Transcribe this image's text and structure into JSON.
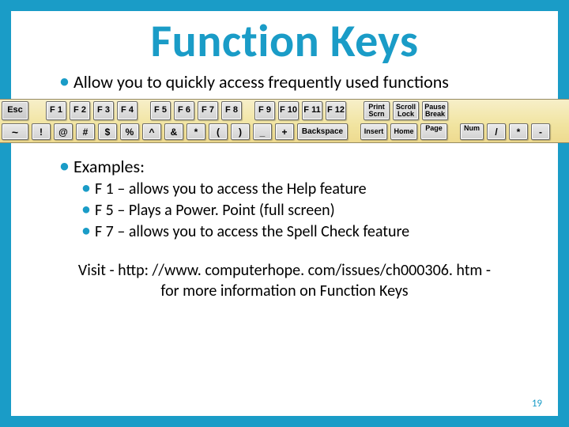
{
  "title": "Function Keys",
  "bullets": {
    "intro": "Allow you to quickly access frequently used functions",
    "examples_label": "Examples:",
    "examples": [
      "F 1 – allows you to access the Help feature",
      "F 5 – Plays a Power. Point (full screen)",
      "F 7 – allows you to access the Spell Check feature"
    ]
  },
  "visit": "Visit  - http: //www. computerhope. com/issues/ch000306. htm - for more information on Function Keys",
  "page_number": "19",
  "keyboard": {
    "row1": {
      "esc": "Esc",
      "fkeys": [
        "F 1",
        "F 2",
        "F 3",
        "F 4",
        "F 5",
        "F 6",
        "F 7",
        "F 8",
        "F 9",
        "F 10",
        "F 11",
        "F 12"
      ],
      "sys": [
        {
          "l1": "Print",
          "l2": "Scrn"
        },
        {
          "l1": "Scroll",
          "l2": "Lock"
        },
        {
          "l1": "Pause",
          "l2": "Break"
        }
      ]
    },
    "row2": {
      "tilde": "~",
      "num": [
        "!",
        "@",
        "#",
        "$",
        "%",
        "^",
        "&",
        "*",
        "(",
        ")",
        "_",
        "+"
      ],
      "backspace": "Backspace",
      "nav": [
        "Insert",
        "Home",
        {
          "l1": "Page",
          "l2": " "
        }
      ],
      "numpad": [
        {
          "l1": "Num",
          "l2": " "
        },
        "/",
        "*",
        "-"
      ]
    }
  }
}
